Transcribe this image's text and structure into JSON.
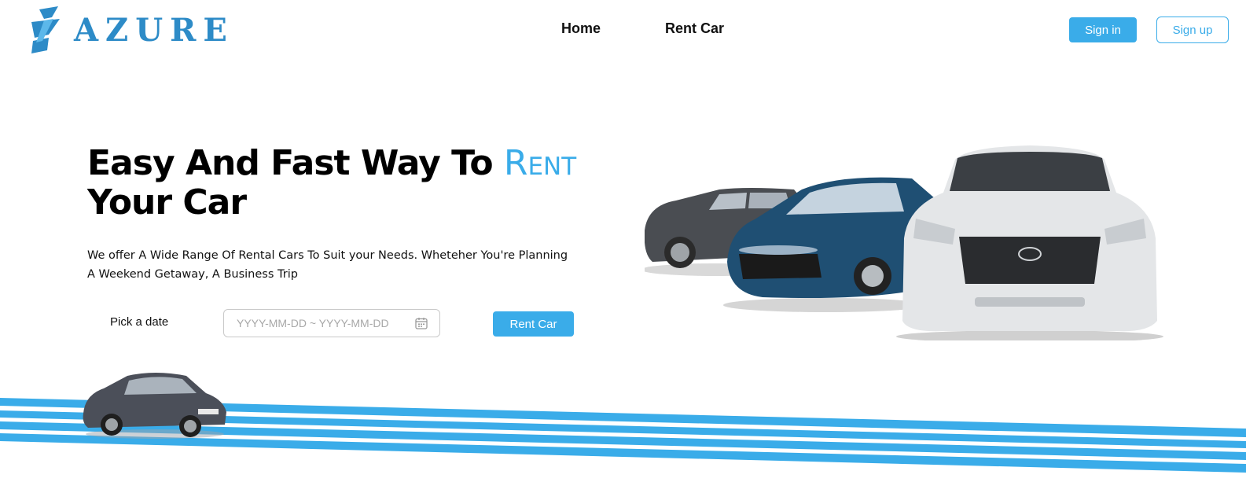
{
  "brand": {
    "name": "AZURE",
    "color": "#2d8bc7"
  },
  "nav": {
    "home": "Home",
    "rent_car": "Rent Car"
  },
  "auth": {
    "sign_in": "Sign in",
    "sign_up": "Sign up"
  },
  "hero": {
    "headline_main": "Easy And Fast Way To",
    "headline_accent": "Rent",
    "headline_end": "Your Car",
    "description": "We offer A Wide Range Of Rental Cars To Suit your Needs. Wheteher You're Planning A Weekend Getaway, A Business Trip"
  },
  "booking": {
    "pick_label": "Pick a date",
    "date_placeholder": "YYYY-MM-DD ~ YYYY-MM-DD",
    "date_value": "",
    "rent_button": "Rent Car"
  },
  "colors": {
    "accent": "#3aace9",
    "text": "#111111"
  },
  "icons": {
    "logo": "azure-logo-icon",
    "calendar": "calendar-icon"
  }
}
